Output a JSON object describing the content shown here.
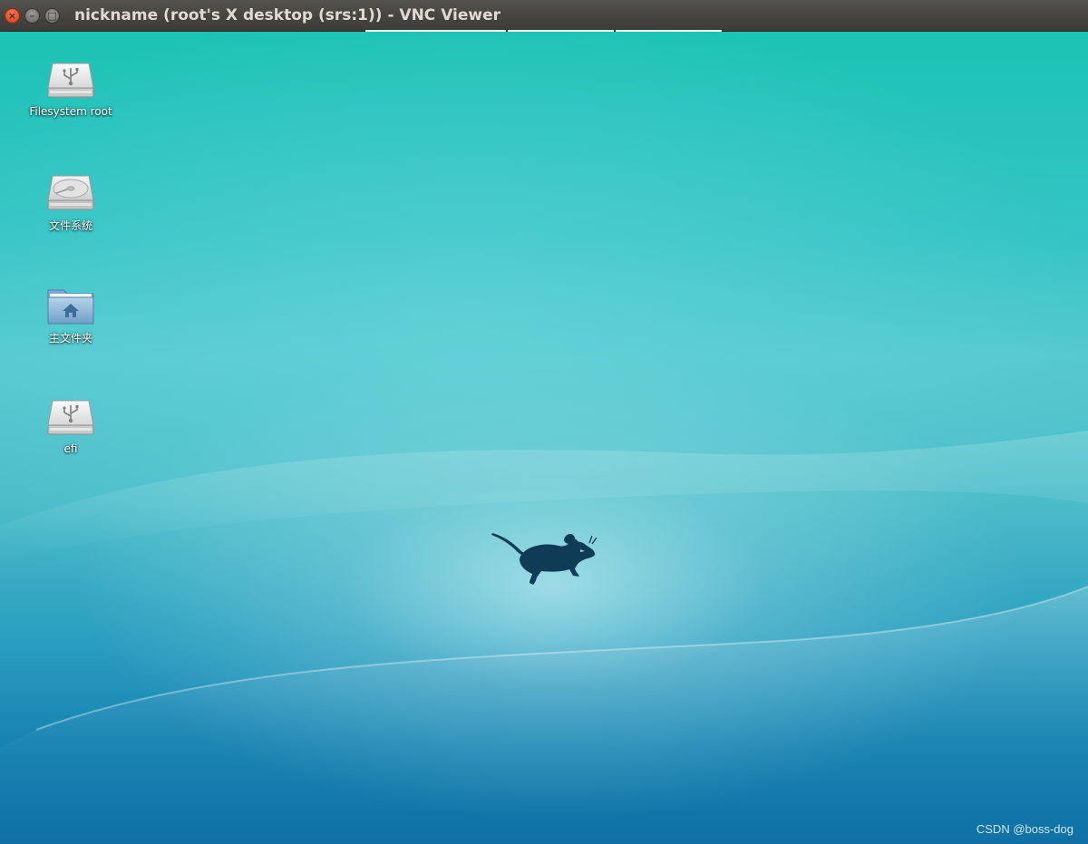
{
  "window": {
    "title": "nickname (root's X desktop (srs:1)) - VNC Viewer",
    "close_symbol": "×",
    "minimize_symbol": "–",
    "maximize_symbol": "□"
  },
  "desktop": {
    "wallpaper": "xfce-teal-wave-mouse",
    "icons": [
      {
        "label": "Filesystem root",
        "icon": "usb-drive-icon"
      },
      {
        "label": "文件系统",
        "icon": "hard-drive-icon"
      },
      {
        "label": "主文件夹",
        "icon": "home-folder-icon"
      },
      {
        "label": "efi",
        "icon": "usb-drive-icon"
      }
    ]
  },
  "watermark": "CSDN @boss-dog",
  "colors": {
    "titlebar": "#3c3b37",
    "close_button": "#e4532e",
    "wallpaper_top": "#1cc3b4",
    "wallpaper_bottom": "#0f70a4",
    "mouse_logo": "#0e3b55"
  }
}
